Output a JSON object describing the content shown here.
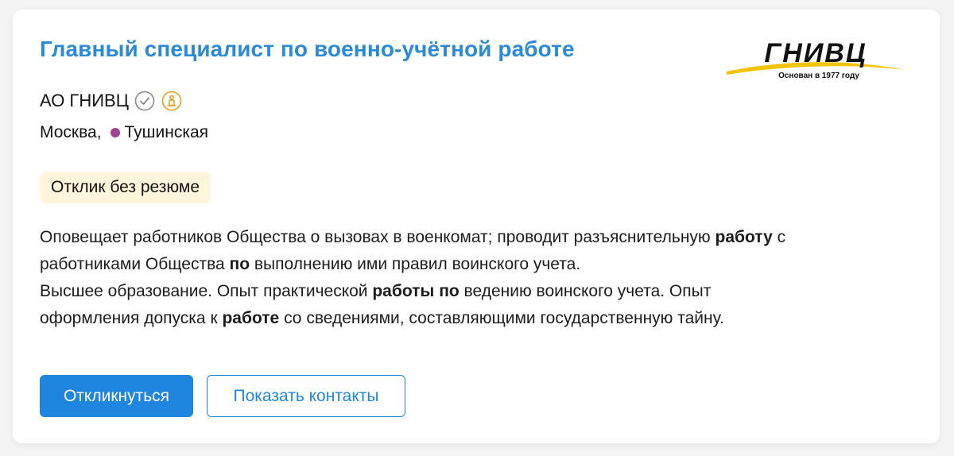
{
  "vacancy": {
    "title": "Главный специалист по военно-учётной работе",
    "company": "АО ГНИВЦ",
    "company_icons": [
      "verified-check-icon",
      "accreditation-icon"
    ],
    "city": "Москва,",
    "metro": "Тушинская",
    "tag": "Отклик без резюме",
    "logo": {
      "name": "ГНИВЦ",
      "tagline": "Основан в 1977 году"
    },
    "description": [
      [
        {
          "t": "Оповещает работников Общества о вызовах в военкомат; проводит разъяснительную "
        },
        {
          "t": "работу",
          "b": true
        },
        {
          "t": " с"
        }
      ],
      [
        {
          "t": "работниками Общества "
        },
        {
          "t": "по",
          "b": true
        },
        {
          "t": " выполнению ими правил воинского учета."
        }
      ],
      [
        {
          "t": "Высшее образование. Опыт практической "
        },
        {
          "t": "работы по",
          "b": true
        },
        {
          "t": " ведению воинского учета. Опыт"
        }
      ],
      [
        {
          "t": "оформления допуска к "
        },
        {
          "t": "работе",
          "b": true
        },
        {
          "t": " со сведениями, составляющими государственную тайну."
        }
      ]
    ]
  },
  "actions": {
    "respond_label": "Откликнуться",
    "show_contacts_label": "Показать контакты"
  },
  "colors": {
    "title": "#2b8ad8",
    "primary_button": "#1f86e0",
    "primary_button_text": "#ffffff",
    "secondary_border": "#1f86e0",
    "secondary_text": "#1f86e0",
    "tag_background": "#fff4dc",
    "metro_line": "#a4418e",
    "verified_icon": "#8a8a8a",
    "accreditation_icon": "#e0a21a",
    "logo_swoosh": "#f2c300"
  }
}
